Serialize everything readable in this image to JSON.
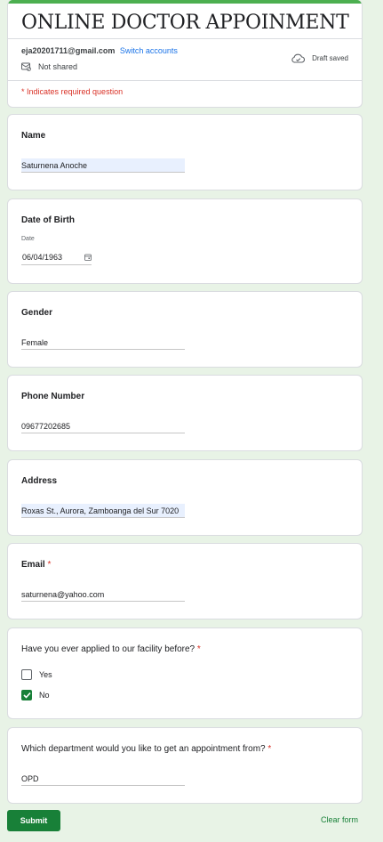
{
  "form": {
    "title": "ONLINE DOCTOR APPOINMENT",
    "account_email": "eja20201711@gmail.com",
    "switch_accounts": "Switch accounts",
    "not_shared": "Not shared",
    "draft_status": "Draft saved",
    "required_note": "* Indicates required question",
    "accent_color": "#188038",
    "header_bar_color": "#4caf50"
  },
  "questions": {
    "name": {
      "title": "Name",
      "value": "Saturnena Anoche"
    },
    "dob": {
      "title": "Date of Birth",
      "sub_label": "Date",
      "value": "06/04/1963"
    },
    "gender": {
      "title": "Gender",
      "value": "Female"
    },
    "phone": {
      "title": "Phone Number",
      "value": "09677202685"
    },
    "address": {
      "title": "Address",
      "value": "Roxas St., Aurora, Zamboanga del Sur 7020"
    },
    "email": {
      "title": "Email",
      "required_mark": "*",
      "value": "saturnena@yahoo.com"
    },
    "applied_before": {
      "title": "Have you ever applied to our facility before?",
      "required_mark": "*",
      "options": [
        {
          "label": "Yes",
          "checked": false
        },
        {
          "label": "No",
          "checked": true
        }
      ]
    },
    "department": {
      "title": "Which department would you like to get an appointment from?",
      "required_mark": "*",
      "value": "OPD"
    }
  },
  "actions": {
    "submit_label": "Submit",
    "clear_label": "Clear form"
  }
}
